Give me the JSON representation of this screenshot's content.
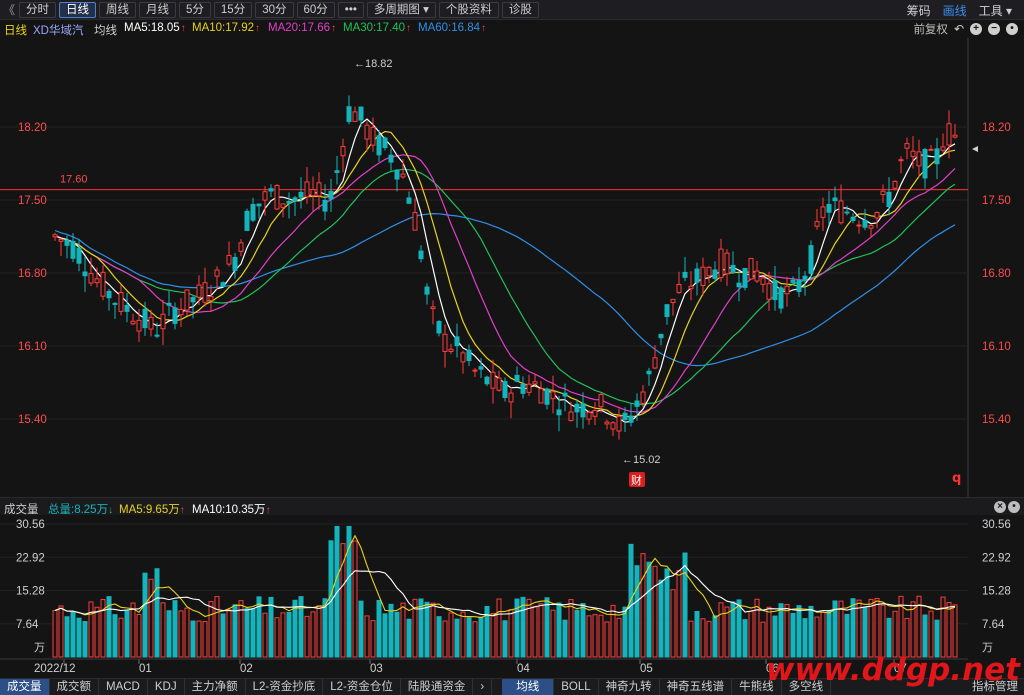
{
  "toolbar": {
    "back_icon": "《",
    "tabs": [
      "分时",
      "日线",
      "周线",
      "月线",
      "5分",
      "15分",
      "30分",
      "60分",
      "•••",
      "多周期图 ▾",
      "个股资料",
      "诊股"
    ],
    "active_tab": "日线",
    "right": [
      "筹码",
      "画线",
      "工具 ▾"
    ],
    "right_active": "画线"
  },
  "ma_legend": {
    "period": "日线",
    "name": "XD华域汽",
    "avg": "均线",
    "items": [
      {
        "label": "MA5:18.05",
        "color": "#ffffff"
      },
      {
        "label": "MA10:17.92",
        "color": "#e8d21e"
      },
      {
        "label": "MA20:17.66",
        "color": "#e040c8"
      },
      {
        "label": "MA30:17.40",
        "color": "#22c05a"
      },
      {
        "label": "MA60:16.84",
        "color": "#2f8fe8"
      }
    ],
    "adjust": "前复权"
  },
  "price_axis": {
    "ticks": [
      "18.20",
      "17.50",
      "16.80",
      "16.10",
      "15.40"
    ],
    "ref_line": "17.60",
    "high_label": "18.82",
    "low_label": "15.02",
    "fin_marker": "财",
    "q_marker": "q"
  },
  "volume": {
    "title": "成交量",
    "total": "总量:8.25万",
    "ma5": "MA5:9.65万",
    "ma10": "MA10:10.35万",
    "ticks": [
      "30.56",
      "22.92",
      "15.28",
      "7.64"
    ],
    "unit": "万"
  },
  "date_axis": [
    "2022/12",
    "01",
    "02",
    "03",
    "04",
    "05",
    "06",
    "07"
  ],
  "bottom_tabs": [
    "成交量",
    "成交额",
    "MACD",
    "KDJ",
    "主力净额",
    "L2-资金抄底",
    "L2-资金仓位",
    "陆股通资金",
    "›",
    "均线",
    "BOLL",
    "神奇九转",
    "神奇五线谱",
    "牛熊线",
    "多空线"
  ],
  "bottom_active": "成交量",
  "bottom_active2": "均线",
  "bottom_right": "指标管理",
  "watermark": "www.ddgp.net",
  "colors": {
    "up": "#ff3b3b",
    "down": "#14b4bc",
    "ma5": "#ffffff",
    "ma10": "#e8d21e",
    "ma20": "#e040c8",
    "ma30": "#22c05a",
    "ma60": "#2f8fe8",
    "accent": "#3a8ef0"
  }
}
